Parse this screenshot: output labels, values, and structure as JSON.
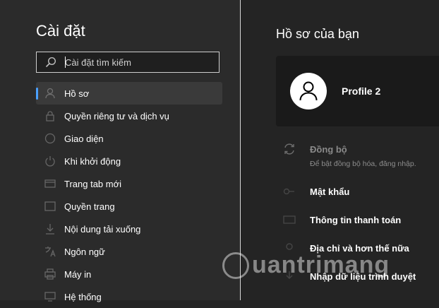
{
  "sidebar": {
    "title": "Cài đặt",
    "search_placeholder": "Cài đặt tìm kiếm",
    "items": [
      {
        "label": "Hồ sơ",
        "icon": "person-icon",
        "active": true
      },
      {
        "label": "Quyền riêng tư và dịch vụ",
        "icon": "lock-icon"
      },
      {
        "label": "Giao diện",
        "icon": "appearance-icon"
      },
      {
        "label": "Khi khởi động",
        "icon": "power-icon"
      },
      {
        "label": "Trang tab mới",
        "icon": "new-tab-icon"
      },
      {
        "label": "Quyền trang",
        "icon": "site-permissions-icon"
      },
      {
        "label": "Nội dung tải xuống",
        "icon": "download-icon"
      },
      {
        "label": "Ngôn ngữ",
        "icon": "language-icon"
      },
      {
        "label": "Máy in",
        "icon": "printer-icon"
      },
      {
        "label": "Hệ thống",
        "icon": "system-icon"
      }
    ]
  },
  "main": {
    "title": "Hồ sơ của bạn",
    "profile": {
      "name": "Profile 2",
      "avatar_icon": "person-icon"
    },
    "sync": {
      "label": "Đồng bộ",
      "subtitle": "Để bật đồng bộ hóa, đăng nhập.",
      "icon": "sync-icon"
    },
    "rows": [
      {
        "label": "Mật khẩu",
        "icon": "key-icon"
      },
      {
        "label": "Thông tin thanh toán",
        "icon": "card-icon"
      },
      {
        "label": "Địa chỉ và hơn thế nữa",
        "icon": "address-icon"
      },
      {
        "label": "Nhập dữ liệu trình duyệt",
        "icon": "import-icon"
      }
    ]
  },
  "watermark": {
    "text": "uantrimang"
  },
  "colors": {
    "accent": "#4aa0ff",
    "sidebar_bg": "#2b2b2b",
    "main_bg": "#242424",
    "card_bg": "#1a1a1a"
  }
}
